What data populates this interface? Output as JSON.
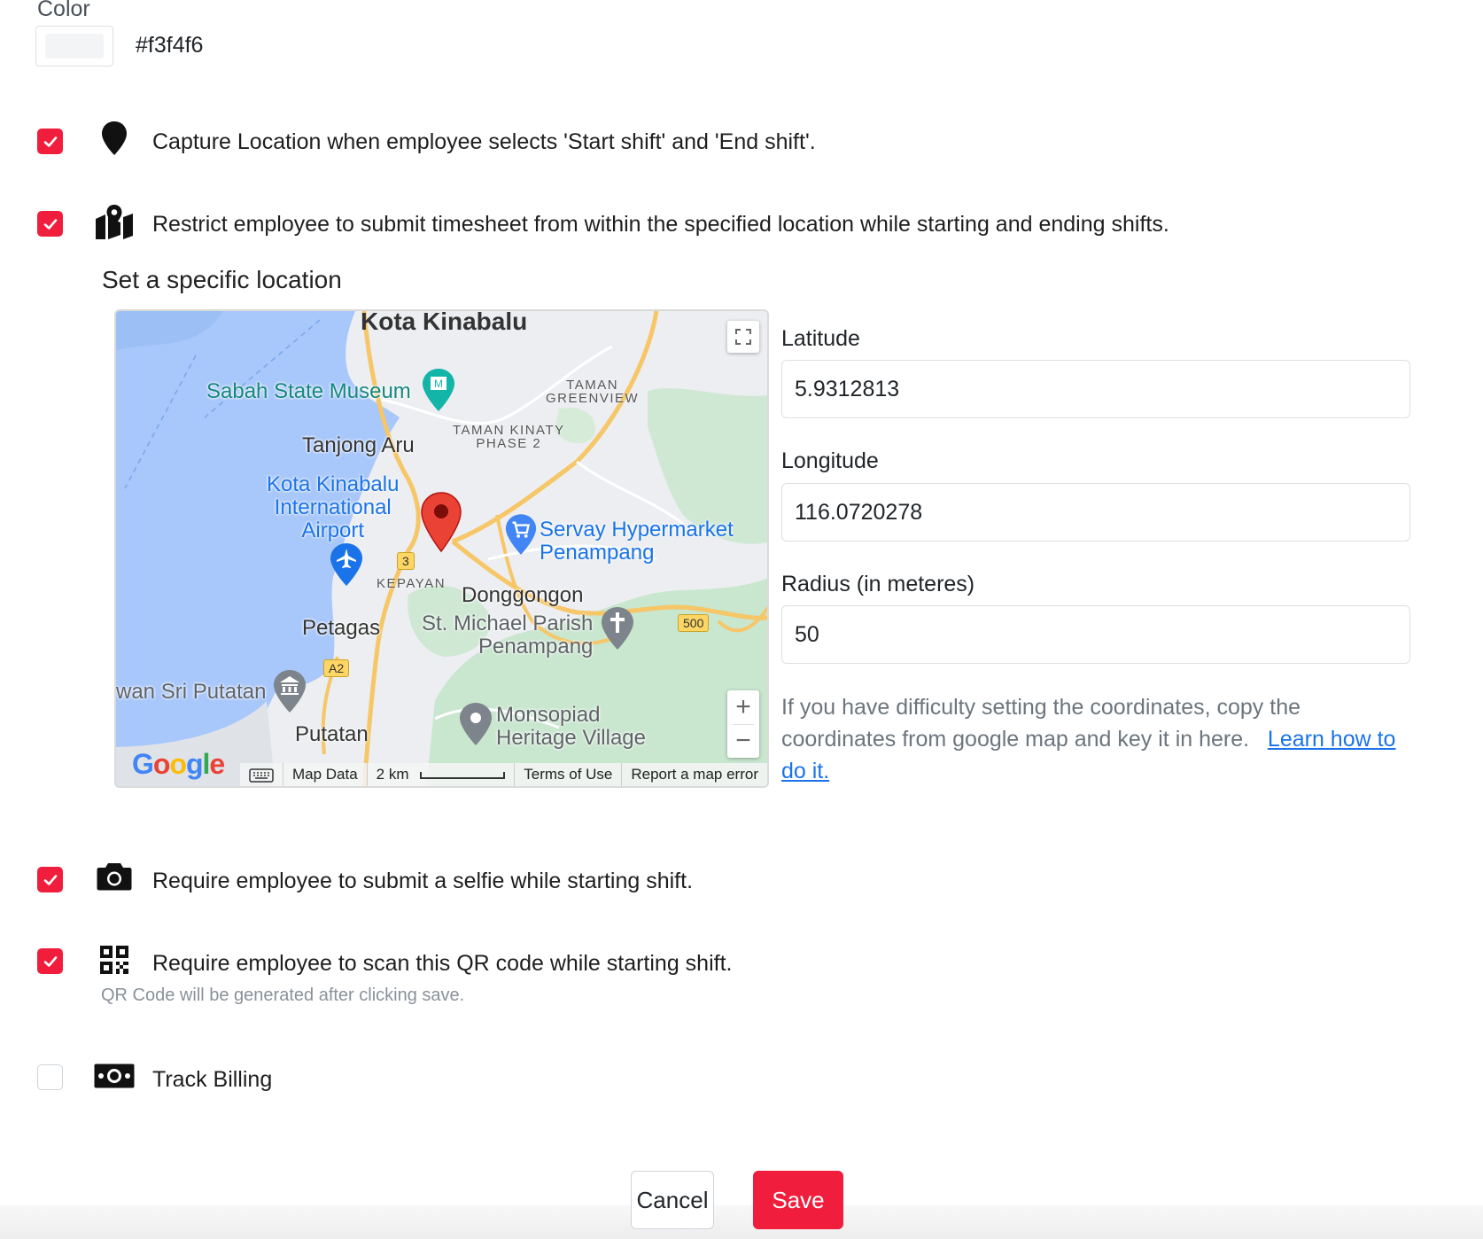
{
  "color": {
    "label": "Color",
    "value": "#f3f4f6",
    "swatch": "#f3f4f6"
  },
  "accent": "#f01e3c",
  "options": [
    {
      "text": "Capture Location when employee selects 'Start shift' and 'End shift'.",
      "checked": true,
      "icon": "map-pin-icon"
    },
    {
      "text": "Restrict employee to submit timesheet from within the specified location while starting and ending shifts.",
      "checked": true,
      "icon": "map-icon"
    },
    {
      "text": "Require employee to submit a selfie while starting shift.",
      "checked": true,
      "icon": "camera-icon"
    },
    {
      "text": "Require employee to scan this QR code while starting shift.",
      "checked": true,
      "icon": "qr-code-icon"
    },
    {
      "text": "Track Billing",
      "checked": false,
      "icon": "money-icon"
    }
  ],
  "location": {
    "title": "Set a specific location",
    "latitude_label": "Latitude",
    "latitude": "5.9312813",
    "longitude_label": "Longitude",
    "longitude": "116.0720278",
    "radius_label": "Radius (in meteres)",
    "radius": "50",
    "help_text": "If you have difficulty setting the coordinates, copy the coordinates from google map and key it in here.",
    "help_link": "Learn how to do it."
  },
  "map": {
    "labels": {
      "city": "Kota Kinabalu",
      "museum": "Sabah State Museum",
      "tanjong_aru": "Tanjong Aru",
      "airport_1": "Kota Kinabalu",
      "airport_2": "International",
      "airport_3": "Airport",
      "greenview_1": "TAMAN",
      "greenview_2": "GREENVIEW",
      "kinaty_1": "TAMAN KINATY",
      "kinaty_2": "PHASE 2",
      "servay_1": "Servay Hypermarket",
      "servay_2": "Penampang",
      "kepayan": "KEPAYAN",
      "donggongon": "Donggongon",
      "stmichael_1": "St. Michael Parish",
      "stmichael_2": "Penampang",
      "petagas": "Petagas",
      "sriputatan": "wan Sri Putatan",
      "putatan": "Putatan",
      "monsopiad_1": "Monsopiad",
      "monsopiad_2": "Heritage Village",
      "shield_3": "3",
      "shield_a2": "A2",
      "shield_500": "500"
    },
    "logo": "Google",
    "footer": {
      "map_data": "Map Data",
      "scale": "2 km",
      "terms": "Terms of Use",
      "report": "Report a map error"
    },
    "zoom_in": "+",
    "zoom_out": "−"
  },
  "qr_hint": "QR Code will be generated after clicking save.",
  "buttons": {
    "cancel": "Cancel",
    "save": "Save"
  }
}
